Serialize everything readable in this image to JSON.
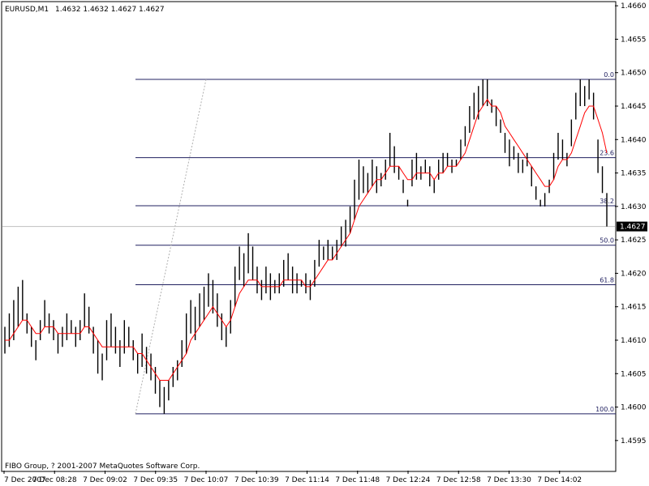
{
  "header": {
    "symbol": "EURUSD,M1",
    "ohlc": "1.4632 1.4632 1.4627 1.4627"
  },
  "copyright": "FIBO Group, ? 2001-2007 MetaQuotes Software Corp.",
  "current_price_label": "1.4627",
  "colors": {
    "background": "#ffffff",
    "bars": "#000000",
    "moving_average": "#ff0000",
    "fibo_levels": "#202060",
    "fibo_trendline": "#b0b0b0",
    "bid_line": "#c0c0c0"
  },
  "chart_data": {
    "type": "ohlc",
    "title": "EURUSD,M1",
    "y_ticks": [
      "1.4660",
      "1.4655",
      "1.4650",
      "1.4645",
      "1.4640",
      "1.4635",
      "1.4630",
      "1.4625",
      "1.4620",
      "1.4615",
      "1.4610",
      "1.4605",
      "1.4600",
      "1.4595"
    ],
    "x_ticks": [
      "7 Dec 2007",
      "7 Dec 08:28",
      "7 Dec 09:02",
      "7 Dec 09:35",
      "7 Dec 10:07",
      "7 Dec 10:39",
      "7 Dec 11:14",
      "7 Dec 11:48",
      "7 Dec 12:24",
      "7 Dec 12:58",
      "7 Dec 13:30",
      "7 Dec 14:02"
    ],
    "ylim": [
      1.45905,
      1.46605
    ],
    "grid": false,
    "bars": [
      [
        1.4612,
        1.4608
      ],
      [
        1.4614,
        1.4609
      ],
      [
        1.4616,
        1.461
      ],
      [
        1.4618,
        1.4612
      ],
      [
        1.4619,
        1.4613
      ],
      [
        1.4614,
        1.4611
      ],
      [
        1.4612,
        1.4609
      ],
      [
        1.461,
        1.4607
      ],
      [
        1.4613,
        1.461
      ],
      [
        1.4616,
        1.4612
      ],
      [
        1.4614,
        1.4611
      ],
      [
        1.4613,
        1.461
      ],
      [
        1.4611,
        1.4608
      ],
      [
        1.4612,
        1.4609
      ],
      [
        1.4614,
        1.461
      ],
      [
        1.4613,
        1.4611
      ],
      [
        1.4612,
        1.4609
      ],
      [
        1.4613,
        1.461
      ],
      [
        1.4617,
        1.4612
      ],
      [
        1.4615,
        1.4611
      ],
      [
        1.4612,
        1.4608
      ],
      [
        1.461,
        1.4605
      ],
      [
        1.4608,
        1.4604
      ],
      [
        1.4613,
        1.4607
      ],
      [
        1.4614,
        1.4609
      ],
      [
        1.4612,
        1.4608
      ],
      [
        1.461,
        1.4606
      ],
      [
        1.4613,
        1.4608
      ],
      [
        1.4612,
        1.4609
      ],
      [
        1.461,
        1.4607
      ],
      [
        1.4608,
        1.4605
      ],
      [
        1.4611,
        1.4606
      ],
      [
        1.4609,
        1.4605
      ],
      [
        1.4608,
        1.4604
      ],
      [
        1.4606,
        1.4602
      ],
      [
        1.4604,
        1.46
      ],
      [
        1.4603,
        1.4599
      ],
      [
        1.4604,
        1.4601
      ],
      [
        1.4606,
        1.4603
      ],
      [
        1.4607,
        1.4604
      ],
      [
        1.461,
        1.4606
      ],
      [
        1.4614,
        1.4608
      ],
      [
        1.4616,
        1.4611
      ],
      [
        1.4615,
        1.461
      ],
      [
        1.4617,
        1.4612
      ],
      [
        1.4618,
        1.4613
      ],
      [
        1.462,
        1.4615
      ],
      [
        1.4619,
        1.4614
      ],
      [
        1.4617,
        1.4612
      ],
      [
        1.4614,
        1.461
      ],
      [
        1.4612,
        1.4609
      ],
      [
        1.4616,
        1.4611
      ],
      [
        1.4621,
        1.4615
      ],
      [
        1.4624,
        1.4619
      ],
      [
        1.4623,
        1.4618
      ],
      [
        1.4626,
        1.462
      ],
      [
        1.4624,
        1.4619
      ],
      [
        1.4621,
        1.4617
      ],
      [
        1.4619,
        1.4616
      ],
      [
        1.4621,
        1.4617
      ],
      [
        1.462,
        1.4616
      ],
      [
        1.4619,
        1.4617
      ],
      [
        1.462,
        1.4617
      ],
      [
        1.4622,
        1.4618
      ],
      [
        1.4623,
        1.4619
      ],
      [
        1.4621,
        1.4617
      ],
      [
        1.462,
        1.4617
      ],
      [
        1.4619,
        1.4618
      ],
      [
        1.462,
        1.4617
      ],
      [
        1.4619,
        1.4616
      ],
      [
        1.4622,
        1.4618
      ],
      [
        1.4625,
        1.4621
      ],
      [
        1.4624,
        1.4622
      ],
      [
        1.4625,
        1.4622
      ],
      [
        1.4624,
        1.4622
      ],
      [
        1.4625,
        1.4622
      ],
      [
        1.4627,
        1.4624
      ],
      [
        1.4628,
        1.4624
      ],
      [
        1.463,
        1.4626
      ],
      [
        1.4634,
        1.4628
      ],
      [
        1.4637,
        1.4631
      ],
      [
        1.4636,
        1.4632
      ],
      [
        1.4635,
        1.4632
      ],
      [
        1.4637,
        1.4633
      ],
      [
        1.4636,
        1.4632
      ],
      [
        1.4635,
        1.4633
      ],
      [
        1.4637,
        1.4634
      ],
      [
        1.4641,
        1.4636
      ],
      [
        1.4639,
        1.4635
      ],
      [
        1.4636,
        1.4634
      ],
      [
        1.4634,
        1.4632
      ],
      [
        1.4631,
        1.463
      ],
      [
        1.4637,
        1.4633
      ],
      [
        1.4638,
        1.4634
      ],
      [
        1.4636,
        1.4634
      ],
      [
        1.4637,
        1.4635
      ],
      [
        1.4636,
        1.4633
      ],
      [
        1.4634,
        1.4632
      ],
      [
        1.4637,
        1.4634
      ],
      [
        1.4638,
        1.4635
      ],
      [
        1.4638,
        1.4636
      ],
      [
        1.4637,
        1.4635
      ],
      [
        1.4637,
        1.4636
      ],
      [
        1.464,
        1.4637
      ],
      [
        1.4642,
        1.4639
      ],
      [
        1.4645,
        1.4641
      ],
      [
        1.4647,
        1.4643
      ],
      [
        1.4648,
        1.4643
      ],
      [
        1.4649,
        1.4645
      ],
      [
        1.4649,
        1.4645
      ],
      [
        1.4646,
        1.4644
      ],
      [
        1.4645,
        1.4642
      ],
      [
        1.4643,
        1.4641
      ],
      [
        1.4641,
        1.4638
      ],
      [
        1.464,
        1.4636
      ],
      [
        1.4639,
        1.4637
      ],
      [
        1.4638,
        1.4635
      ],
      [
        1.4637,
        1.4635
      ],
      [
        1.4638,
        1.4636
      ],
      [
        1.4636,
        1.4633
      ],
      [
        1.4633,
        1.4631
      ],
      [
        1.4631,
        1.463
      ],
      [
        1.4632,
        1.463
      ],
      [
        1.4634,
        1.4632
      ],
      [
        1.4638,
        1.4634
      ],
      [
        1.4641,
        1.4637
      ],
      [
        1.464,
        1.4637
      ],
      [
        1.4638,
        1.4636
      ],
      [
        1.4643,
        1.4639
      ],
      [
        1.4647,
        1.4643
      ],
      [
        1.4649,
        1.4645
      ],
      [
        1.4648,
        1.4645
      ],
      [
        1.4649,
        1.4646
      ],
      [
        1.4647,
        1.4643
      ],
      [
        1.464,
        1.4635
      ],
      [
        1.4636,
        1.4632
      ],
      [
        1.4632,
        1.4627
      ]
    ],
    "moving_average": [
      1.461,
      1.461,
      1.4611,
      1.4612,
      1.4613,
      1.4613,
      1.4612,
      1.4611,
      1.4611,
      1.4612,
      1.4612,
      1.4612,
      1.4611,
      1.4611,
      1.4611,
      1.4611,
      1.4611,
      1.4611,
      1.4612,
      1.4612,
      1.4611,
      1.461,
      1.4609,
      1.4609,
      1.4609,
      1.4609,
      1.4609,
      1.4609,
      1.4609,
      1.4609,
      1.4608,
      1.4608,
      1.4607,
      1.4606,
      1.4605,
      1.4604,
      1.4604,
      1.4604,
      1.4605,
      1.4606,
      1.4607,
      1.4608,
      1.461,
      1.4611,
      1.4612,
      1.4613,
      1.4614,
      1.4615,
      1.4614,
      1.4613,
      1.4612,
      1.4613,
      1.4615,
      1.4617,
      1.4618,
      1.4619,
      1.4619,
      1.4619,
      1.4618,
      1.4618,
      1.4618,
      1.4618,
      1.4618,
      1.4619,
      1.4619,
      1.4619,
      1.4619,
      1.4619,
      1.4618,
      1.4618,
      1.4619,
      1.462,
      1.4621,
      1.4622,
      1.4622,
      1.4623,
      1.4624,
      1.4625,
      1.4626,
      1.4628,
      1.463,
      1.4631,
      1.4632,
      1.4633,
      1.4634,
      1.4634,
      1.4635,
      1.4636,
      1.4636,
      1.4636,
      1.4635,
      1.4634,
      1.4634,
      1.4635,
      1.4635,
      1.4635,
      1.4635,
      1.4634,
      1.4635,
      1.4635,
      1.4636,
      1.4636,
      1.4636,
      1.4637,
      1.4638,
      1.464,
      1.4642,
      1.4644,
      1.4645,
      1.4646,
      1.4645,
      1.4645,
      1.4644,
      1.4642,
      1.4641,
      1.464,
      1.4639,
      1.4638,
      1.4637,
      1.4636,
      1.4635,
      1.4634,
      1.4633,
      1.4633,
      1.4634,
      1.4636,
      1.4637,
      1.4637,
      1.4638,
      1.464,
      1.4642,
      1.4644,
      1.4645,
      1.4645,
      1.4643,
      1.4641,
      1.4638
    ],
    "fibo_levels": [
      {
        "label": "0.0",
        "price": 1.4649
      },
      {
        "label": "23.6",
        "price": 1.46373
      },
      {
        "label": "38.2",
        "price": 1.46301
      },
      {
        "label": "50.0",
        "price": 1.46242
      },
      {
        "label": "61.8",
        "price": 1.46183
      },
      {
        "label": "100.0",
        "price": 1.4599
      }
    ],
    "fibo_trendline": [
      [
        1.4599,
        1.4649
      ]
    ],
    "current_price": 1.4627
  }
}
